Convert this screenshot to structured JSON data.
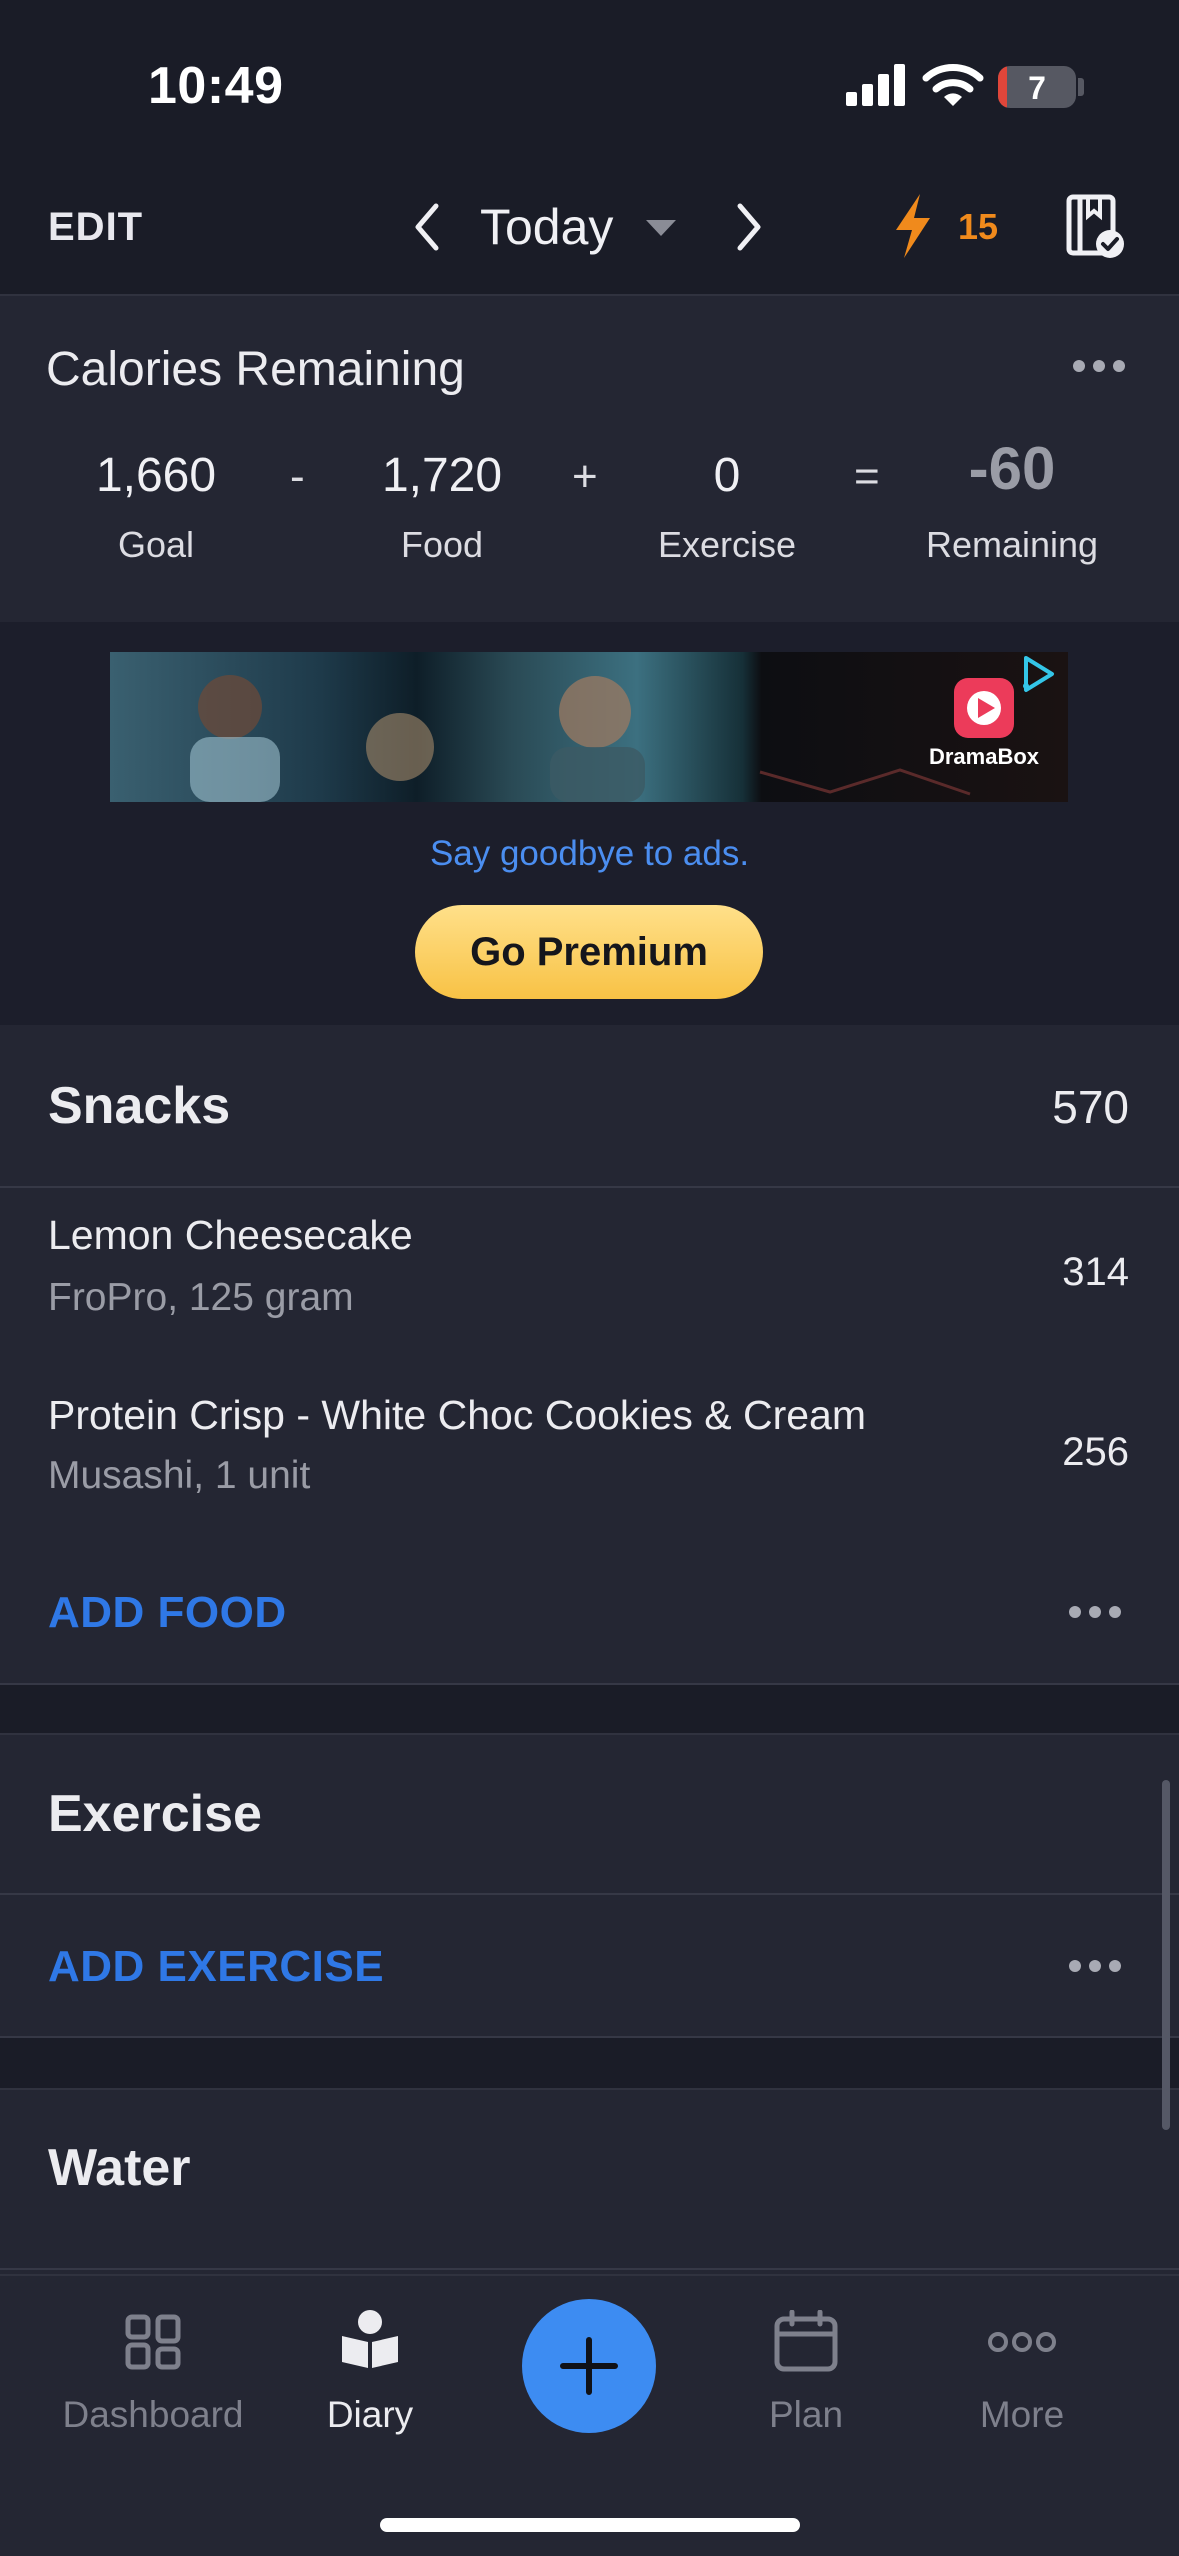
{
  "status_bar": {
    "time": "10:49",
    "battery_level": "7"
  },
  "header": {
    "edit_label": "EDIT",
    "date_label": "Today",
    "streak_count": "15"
  },
  "calories": {
    "title": "Calories Remaining",
    "goal": {
      "value": "1,660",
      "label": "Goal"
    },
    "food": {
      "value": "1,720",
      "label": "Food"
    },
    "exercise": {
      "value": "0",
      "label": "Exercise"
    },
    "remaining": {
      "value": "-60",
      "label": "Remaining"
    },
    "op_minus": "-",
    "op_plus": "+",
    "op_equals": "="
  },
  "ad": {
    "brand": "DramaBox",
    "goodbye_text": "Say goodbye to ads.",
    "premium_label": "Go Premium"
  },
  "snacks": {
    "title": "Snacks",
    "total": "570",
    "items": [
      {
        "name": "Lemon Cheesecake",
        "detail": "FroPro, 125 gram",
        "calories": "314"
      },
      {
        "name": "Protein Crisp - White Choc Cookies & Cream",
        "detail": "Musashi, 1 unit",
        "calories": "256"
      }
    ],
    "add_label": "ADD FOOD"
  },
  "exercise": {
    "title": "Exercise",
    "add_label": "ADD EXERCISE"
  },
  "water": {
    "title": "Water"
  },
  "tabs": [
    {
      "label": "Dashboard",
      "icon": "dashboard-icon"
    },
    {
      "label": "Diary",
      "icon": "diary-icon",
      "active": true
    },
    {
      "label": "Plan",
      "icon": "calendar-icon"
    },
    {
      "label": "More",
      "icon": "more-icon"
    }
  ],
  "colors": {
    "accent": "#3d8cf2",
    "link": "#2f78e6",
    "streak": "#f08a1c",
    "premium": "#f8c245",
    "background": "#1a1c27",
    "panel": "#242633"
  }
}
